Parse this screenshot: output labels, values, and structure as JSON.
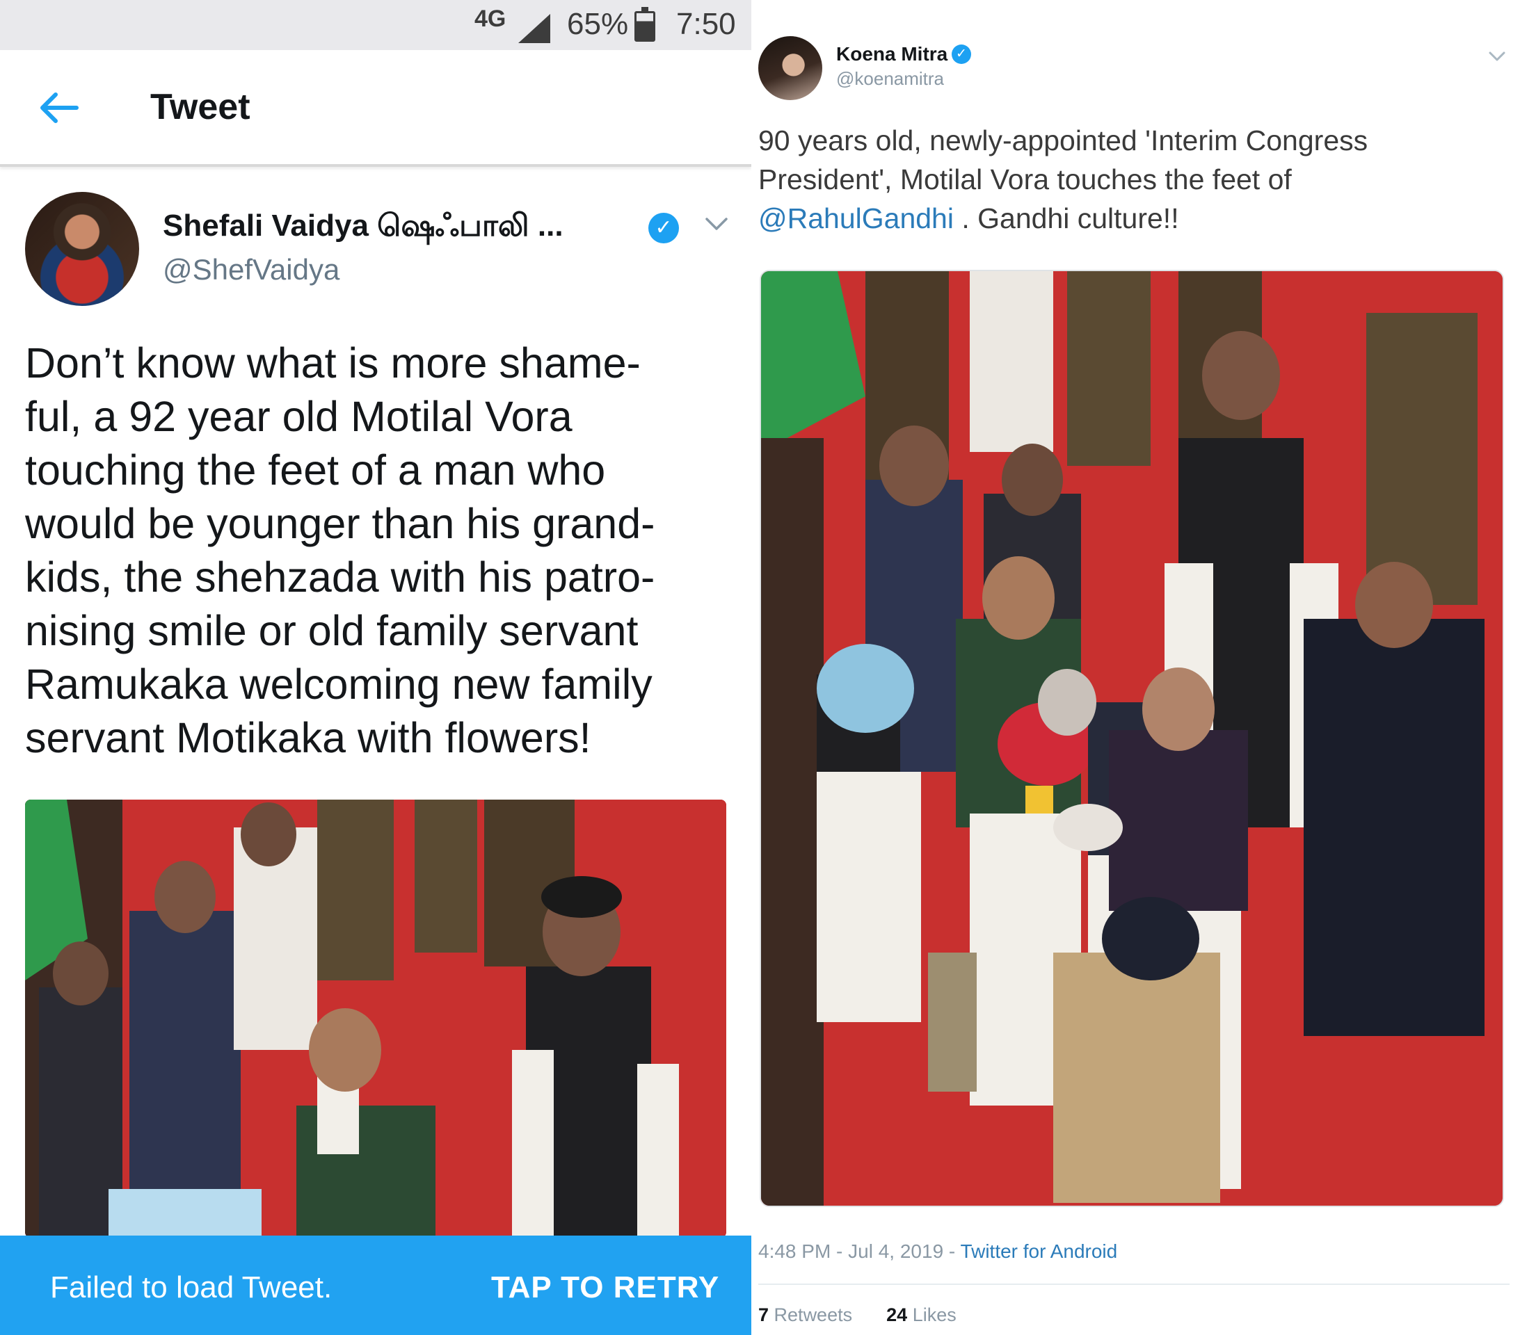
{
  "left_panel": {
    "status_bar": {
      "network": "4G",
      "battery": "65%",
      "time": "7:50"
    },
    "app_bar": {
      "title": "Tweet",
      "back_icon": "back-arrow-icon"
    },
    "tweet": {
      "author_name": "Shefali Vaidya ஷெஃபாலி ...",
      "handle": "@ShefVaidya",
      "verified": true,
      "text_lines": [
        "Don’t know what is more shame-",
        "ful, a 92 year old Motilal Vora",
        "touching the feet of a man who",
        "would be younger than his grand-",
        "kids, the shehzada with his patro-",
        "nising smile or old family servant",
        "Ramukaka welcoming new family",
        "servant Motikaka with flowers!"
      ]
    },
    "error_bar": {
      "message": "Failed to load Tweet.",
      "action": "TAP TO RETRY"
    }
  },
  "right_panel": {
    "tweet": {
      "author_name": "Koena Mitra",
      "handle": "@koenamitra",
      "verified": true,
      "text_line1": "90 years old, newly-appointed 'Interim Congress",
      "text_line2": "President', Motilal Vora touches the feet of",
      "mention": "@RahulGandhi",
      "text_line3_rest": " .  Gandhi culture!!",
      "timestamp": "4:48 PM - Jul 4, 2019",
      "separator": " - ",
      "source": "Twitter for Android",
      "retweets_count": "7",
      "retweets_label": "Retweets",
      "likes_count": "24",
      "likes_label": "Likes"
    }
  },
  "colors": {
    "twitter_blue": "#1da1f2",
    "error_bar": "#21a2f1",
    "carpet_red": "#c32a2c",
    "status_bar_bg": "#e9e9ec"
  }
}
